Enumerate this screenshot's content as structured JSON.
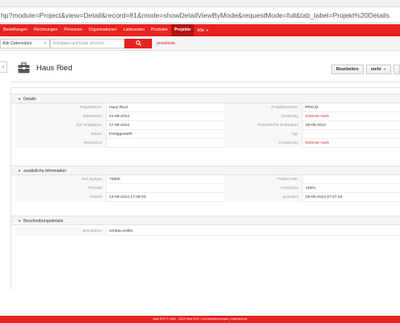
{
  "browser": {
    "url": "hp?module=Project&view=Detail&record=81&mode=showDetailViewByMode&requestMode=full&tab_label=Projekt%20Details"
  },
  "nav": {
    "items": [
      "Bestellungen",
      "Rechnungen",
      "Personen",
      "Organisationen",
      "Lieferanten",
      "Produkte",
      "Projekte",
      "Alle"
    ],
    "active_index": 6
  },
  "search": {
    "scope": "Alle Datensätze",
    "placeholder": "Eintippen und Enter drücken",
    "advanced_label": "erweiterte"
  },
  "record": {
    "title": "Haus Ried",
    "edit_label": "Bearbeiten",
    "more_label": "mehr"
  },
  "blocks": {
    "details": {
      "title": "Details",
      "rows": [
        {
          "l1": "Projektname",
          "v1": "Haus Ried",
          "l2": "Projektnummer",
          "v2": "PROJ2"
        },
        {
          "l1": "Startdatum",
          "v1": "01-08-2014",
          "l2": "zuständig",
          "v2": "Dietmar Harb"
        },
        {
          "l1": "Ziel Enddatum",
          "v1": "27-09-2014",
          "l2": "Tatsächliche Enddatum",
          "v2": "30-09-2014"
        },
        {
          "l1": "Status",
          "v1": "Fertiggestellt",
          "l2": "Typ",
          "v2": ""
        },
        {
          "l1": "Related to",
          "v1": "",
          "l2": "Created By",
          "v2": "Dietmar Harb"
        }
      ]
    },
    "additional": {
      "title": "zusätzliche Information",
      "rows": [
        {
          "l1": "Ziel Budget",
          "v1": "70000",
          "l2": "Projekt URL",
          "v2": ""
        },
        {
          "l1": "Priorität",
          "v1": "",
          "l2": "Fortschritt",
          "v2": "100%"
        },
        {
          "l1": "erstellt",
          "v1": "13-09-2014 17:38:33",
          "l2": "geändert",
          "v2": "25-09-2014 07:37:44"
        }
      ]
    },
    "description": {
      "title": "Beschreibungsdetails",
      "rows": [
        {
          "l1": "description",
          "v1": "Umbau Keller"
        }
      ]
    }
  },
  "footer": {
    "text": "Harb EDV  © 2001 - 2014  Harb EDV | Lizenzbestimmungen | Datenschutz"
  },
  "colors": {
    "brand": "#e8231f",
    "link": "#d02a2a"
  }
}
